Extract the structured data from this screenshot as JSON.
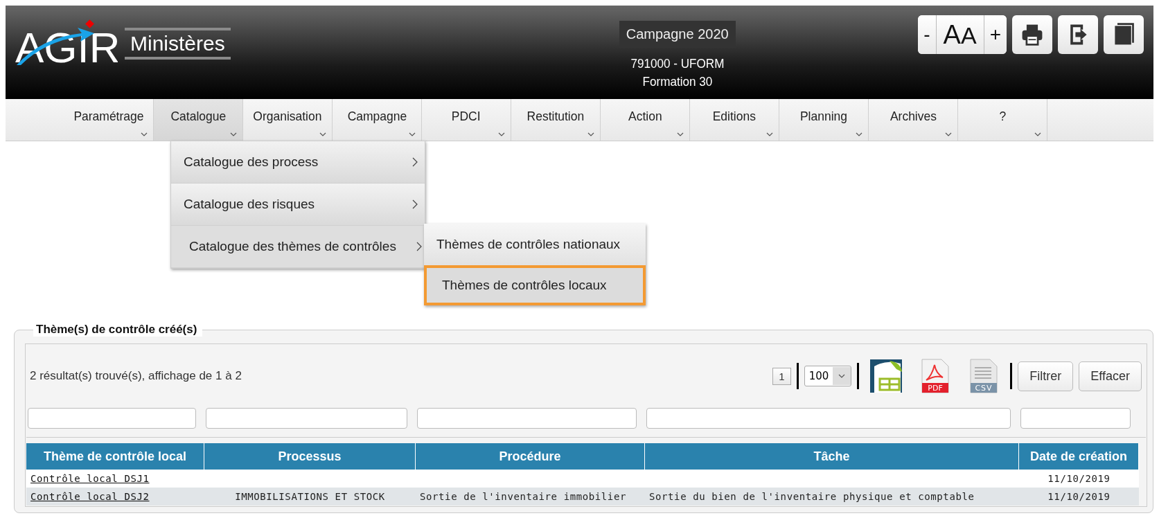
{
  "header": {
    "logo": {
      "name": "AGIR",
      "subtitle": "Ministères"
    },
    "campaign": "Campagne 2020",
    "entity": [
      "791000 - UFORM",
      "Formation 30"
    ],
    "font_controls": [
      "-",
      "AA",
      "+"
    ],
    "tools": [
      {
        "kind": "print"
      },
      {
        "kind": "exit"
      },
      {
        "kind": "book"
      }
    ]
  },
  "menu": [
    {
      "label": "Paramétrage",
      "selected": false
    },
    {
      "label": "Catalogue",
      "selected": true
    },
    {
      "label": "Organisation",
      "selected": false
    },
    {
      "label": "Campagne",
      "selected": false
    },
    {
      "label": "PDCI",
      "selected": false
    },
    {
      "label": "Restitution",
      "selected": false
    },
    {
      "label": "Action",
      "selected": false
    },
    {
      "label": "Editions",
      "selected": false
    },
    {
      "label": "Planning",
      "selected": false
    },
    {
      "label": "Archives",
      "selected": false
    },
    {
      "label": "?",
      "selected": false
    }
  ],
  "dropdown": {
    "items": [
      {
        "label": "Catalogue des process",
        "selected": false
      },
      {
        "label": "Catalogue des risques",
        "selected": false
      },
      {
        "label": "Catalogue des thèmes de contrôles",
        "selected": true
      }
    ],
    "submenu": [
      {
        "label": "Thèmes de contrôles nationaux",
        "selected": false
      },
      {
        "label": "Thèmes de contrôles locaux",
        "selected": true
      }
    ]
  },
  "results": {
    "title": "Thème(s) de contrôle créé(s)",
    "summary": "2 résultat(s) trouvé(s), affichage de 1 à 2",
    "page": "1",
    "page_size": "100",
    "exports": [
      {
        "kind": "sheet"
      },
      {
        "kind": "pdf",
        "label": "PDF"
      },
      {
        "kind": "csv",
        "label": "CSV"
      }
    ],
    "buttons": [
      "Filtrer",
      "Effacer"
    ],
    "columns": [
      "Thème de contrôle local",
      "Processus",
      "Procédure",
      "Tâche",
      "Date de création"
    ],
    "rows": [
      {
        "theme": "Contrôle local DSJ1",
        "date": "11/10/2019"
      },
      {
        "theme": "Contrôle local DSJ2",
        "processus": "IMMOBILISATIONS ET STOCK",
        "procedure": "Sortie de l'inventaire immobilier",
        "tache": "Sortie du bien de l'inventaire physique et comptable",
        "date": "11/10/2019"
      }
    ]
  }
}
